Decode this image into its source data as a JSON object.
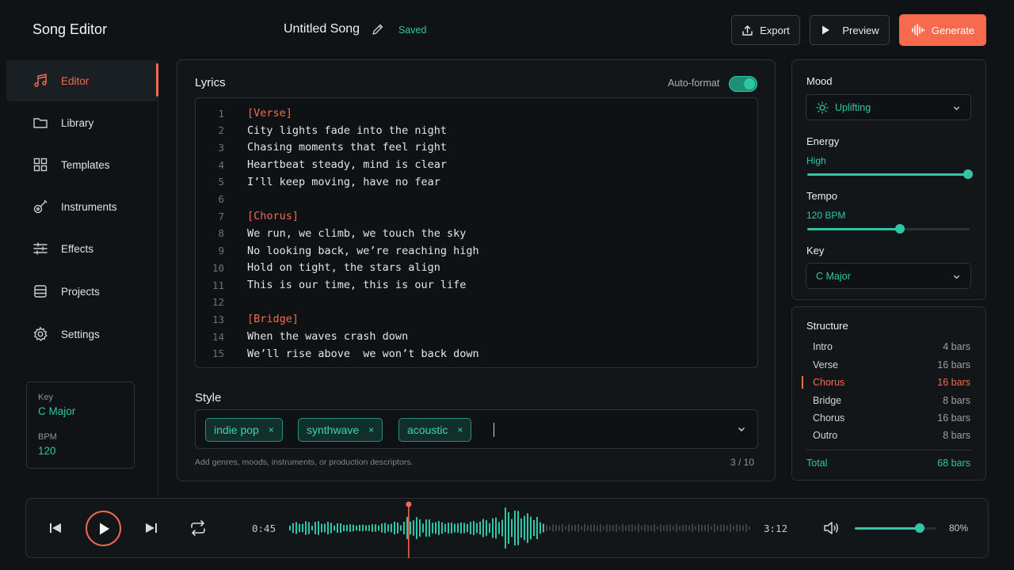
{
  "header": {
    "app_title": "Song Editor",
    "song_title": "Untitled Song",
    "save_status": "Saved",
    "export_label": "Export",
    "preview_label": "Preview",
    "generate_label": "Generate"
  },
  "sidebar": {
    "items": [
      {
        "label": "Editor",
        "icon": "music-note-icon",
        "active": true
      },
      {
        "label": "Library",
        "icon": "folder-icon"
      },
      {
        "label": "Templates",
        "icon": "grid-icon"
      },
      {
        "label": "Instruments",
        "icon": "guitar-icon"
      },
      {
        "label": "Effects",
        "icon": "sliders-icon"
      },
      {
        "label": "Projects",
        "icon": "stack-icon"
      },
      {
        "label": "Settings",
        "icon": "gear-icon"
      }
    ],
    "info": {
      "key_label": "Key",
      "key_value": "C Major",
      "bpm_label": "BPM",
      "bpm_value": "120"
    }
  },
  "lyrics": {
    "title": "Lyrics",
    "autoformat_label": "Auto-format",
    "autoformat_on": true,
    "lines": [
      {
        "n": "1",
        "text": "[Verse]",
        "section": true
      },
      {
        "n": "2",
        "text": "City lights fade into the night"
      },
      {
        "n": "3",
        "text": "Chasing moments that feel right"
      },
      {
        "n": "4",
        "text": "Heartbeat steady, mind is clear"
      },
      {
        "n": "5",
        "text": "I’ll keep moving, have no fear"
      },
      {
        "n": "6",
        "text": ""
      },
      {
        "n": "7",
        "text": "[Chorus]",
        "section": true
      },
      {
        "n": "8",
        "text": "We run, we climb, we touch the sky"
      },
      {
        "n": "9",
        "text": "No looking back, we’re reaching high"
      },
      {
        "n": "10",
        "text": "Hold on tight, the stars align"
      },
      {
        "n": "11",
        "text": "This is our time, this is our life"
      },
      {
        "n": "12",
        "text": ""
      },
      {
        "n": "13",
        "text": "[Bridge]",
        "section": true
      },
      {
        "n": "14",
        "text": "When the waves crash down"
      },
      {
        "n": "15",
        "text": "We’ll rise above  we won’t back down"
      }
    ]
  },
  "style": {
    "title": "Style",
    "tags": [
      "indie pop",
      "synthwave",
      "acoustic"
    ],
    "remove_glyph": "×",
    "hint": "Add genres, moods, instruments, or production descriptors.",
    "count": "3 / 10"
  },
  "settings": {
    "mood_label": "Mood",
    "mood_value": "Uplifting",
    "energy_label": "Energy",
    "energy_value": "High",
    "energy_level": 1.0,
    "tempo_label": "Tempo",
    "tempo_value": "120 BPM",
    "tempo_level": 0.57,
    "key_label": "Key",
    "key_value": "C Major"
  },
  "structure": {
    "title": "Structure",
    "rows": [
      {
        "name": "Intro",
        "bars": "4 bars"
      },
      {
        "name": "Verse",
        "bars": "16 bars"
      },
      {
        "name": "Chorus",
        "bars": "16 bars",
        "active": true
      },
      {
        "name": "Bridge",
        "bars": "8 bars"
      },
      {
        "name": "Chorus",
        "bars": "16 bars"
      },
      {
        "name": "Outro",
        "bars": "8 bars"
      }
    ],
    "total_label": "Total",
    "total_value": "68 bars"
  },
  "player": {
    "current_time": "0:45",
    "duration": "3:12",
    "progress": 0.26,
    "volume_level": 0.8,
    "volume_text": "80%"
  },
  "colors": {
    "accent": "#f36a50",
    "teal": "#2fc6a5",
    "background": "#101316"
  }
}
